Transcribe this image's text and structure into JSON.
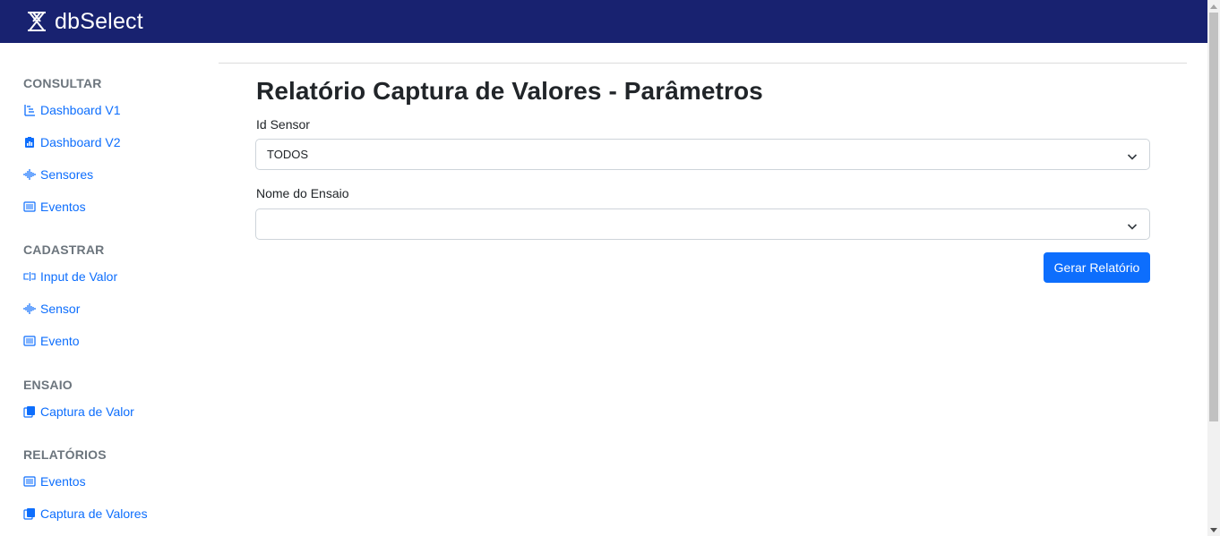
{
  "app": {
    "title": "dbSelect"
  },
  "sidebar": {
    "sections": [
      {
        "heading": "CONSULTAR",
        "items": [
          {
            "label": "Dashboard V1",
            "icon": "tree-list-icon"
          },
          {
            "label": "Dashboard V2",
            "icon": "clipboard-chart-icon"
          },
          {
            "label": "Sensores",
            "icon": "waveform-icon"
          },
          {
            "label": "Eventos",
            "icon": "list-icon"
          }
        ]
      },
      {
        "heading": "CADASTRAR",
        "items": [
          {
            "label": "Input de Valor",
            "icon": "input-cursor-icon"
          },
          {
            "label": "Sensor",
            "icon": "waveform-icon"
          },
          {
            "label": "Evento",
            "icon": "list-icon"
          }
        ]
      },
      {
        "heading": "ENSAIO",
        "items": [
          {
            "label": "Captura de Valor",
            "icon": "copy-stack-icon"
          }
        ]
      },
      {
        "heading": "RELATÓRIOS",
        "items": [
          {
            "label": "Eventos",
            "icon": "list-icon"
          },
          {
            "label": "Captura de Valores",
            "icon": "copy-stack-icon"
          }
        ]
      }
    ]
  },
  "main": {
    "title": "Relatório Captura de Valores - Parâmetros",
    "fields": [
      {
        "label": "Id Sensor",
        "value": "TODOS"
      },
      {
        "label": "Nome do Ensaio",
        "value": ""
      }
    ],
    "submit_label": "Gerar Relatório"
  },
  "colors": {
    "header_bg": "#182270",
    "link": "#0d6efd",
    "button_bg": "#0d6efd",
    "section_heading": "#6c757d"
  }
}
